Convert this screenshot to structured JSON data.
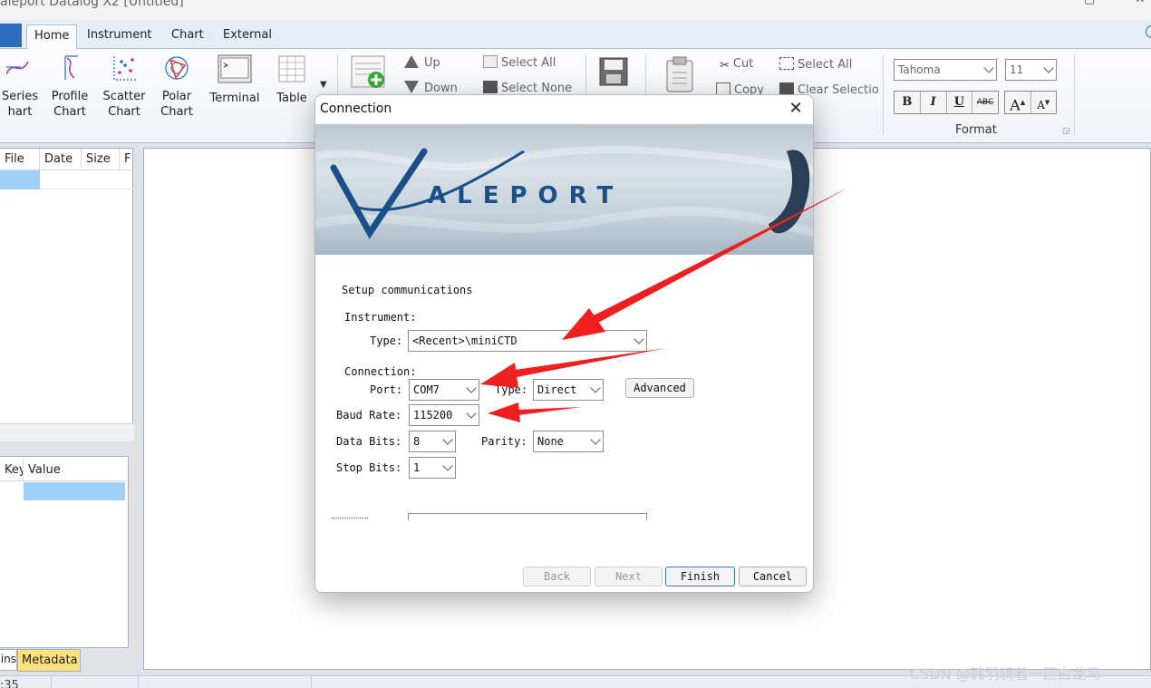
{
  "window": {
    "title": "aleport Datalog X2 [Untitled]"
  },
  "tabs": [
    {
      "label": "Home",
      "active": true
    },
    {
      "label": "Instrument"
    },
    {
      "label": "Chart"
    },
    {
      "label": "External"
    }
  ],
  "ribbon": {
    "charts": [
      {
        "line1": "Series",
        "line2": "hart"
      },
      {
        "line1": "Profile",
        "line2": "Chart"
      },
      {
        "line1": "Scatter",
        "line2": "Chart"
      },
      {
        "line1": "Polar",
        "line2": "Chart"
      }
    ],
    "terminal": "Terminal",
    "table": "Table",
    "up": "Up",
    "down": "Down",
    "select_all": "Select All",
    "select_none": "Select None",
    "cut": "Cut",
    "copy": "Copy",
    "select_all_2": "Select All",
    "clear_selection": "Clear Selectio",
    "font_name": "Tahoma",
    "font_size": "11",
    "format_label": "Format",
    "bold": "B",
    "italic": "I",
    "underline": "U",
    "strike": "ABC"
  },
  "files_panel": {
    "headers": [
      "File",
      "Date",
      "Size",
      "F"
    ]
  },
  "meta_panel": {
    "headers": [
      "Key",
      "Value"
    ]
  },
  "bottom_tabs": {
    "left": "ins",
    "right": "Metadata"
  },
  "status": {
    "time": ":35"
  },
  "dialog": {
    "title": "Connection",
    "logo": "ALEPORT",
    "heading": "Setup communications",
    "instrument_label": "Instrument:",
    "type_label": "Type:",
    "type_value": "<Recent>\\miniCTD",
    "connection_label": "Connection:",
    "port_label": "Port:",
    "port_value": "COM7",
    "conn_type_label": "Type:",
    "conn_type_value": "Direct",
    "advanced": "Advanced",
    "baud_label": "Baud Rate:",
    "baud_value": "115200",
    "databits_label": "Data Bits:",
    "databits_value": "8",
    "parity_label": "Parity:",
    "parity_value": "None",
    "stopbits_label": "Stop Bits:",
    "stopbits_value": "1",
    "buttons": {
      "back": "Back",
      "next": "Next",
      "finish": "Finish",
      "cancel": "Cancel"
    }
  },
  "watermark": "CSDN @韩羽骑着一匹白龙马",
  "colors": {
    "accent": "#2c6cbf",
    "logo_blue": "#1a4f8a",
    "arrow": "#f01f1f",
    "selection": "#9fd0f5",
    "metadata_tab": "#fde17a"
  }
}
